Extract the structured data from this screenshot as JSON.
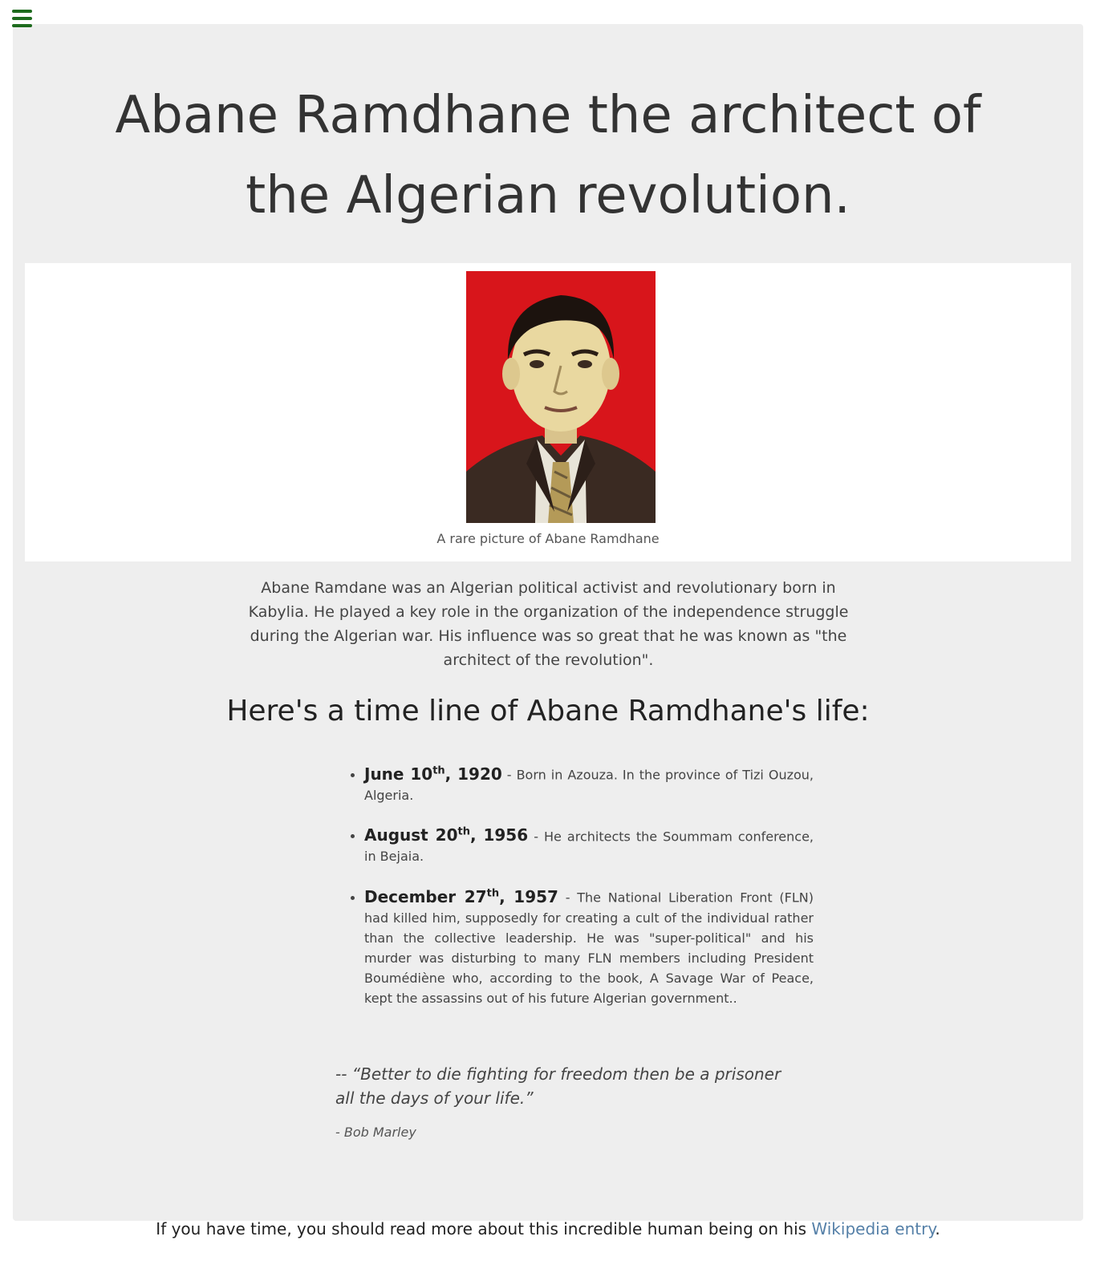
{
  "page": {
    "title": "Abane Ramdhane the architect of the Algerian revolution."
  },
  "figure": {
    "image_alt": "Portrait of Abane Ramdhane",
    "caption": "A rare picture of Abane Ramdhane"
  },
  "intro": "Abane Ramdane was an Algerian political activist and revolutionary born in Kabylia. He played a key role in the organization of the independence struggle during the Algerian war. His influence was so great that he was known as \"the architect of the revolution\".",
  "timeline": {
    "heading": "Here's a time line of Abane Ramdhane's life:",
    "items": [
      {
        "date_month": "June 10",
        "date_suffix": "th",
        "date_year": ", 1920",
        "text": " - Born in Azouza. In the province of Tizi Ouzou, Algeria."
      },
      {
        "date_month": "August 20",
        "date_suffix": "th",
        "date_year": ", 1956",
        "text": " - He architects the Soummam conference, in Bejaia."
      },
      {
        "date_month": "December 27",
        "date_suffix": "th",
        "date_year": ", 1957",
        "text": " - The National Liberation Front (FLN) had killed him, supposedly for creating a cult of the individual rather than the collective leadership. He was \"super-political\" and his murder was disturbing to many FLN members including President Boumédiène who, according to the book, A Savage War of Peace, kept the assassins out of his future Algerian government.."
      }
    ]
  },
  "quote": {
    "text": "-- “Better to die fighting for freedom then be a prisoner all the days of your life.”",
    "author": "- Bob Marley"
  },
  "footer": {
    "text": "If you have time, you should read more about this incredible human being on his ",
    "link_text": "Wikipedia entry",
    "end": "."
  },
  "colors": {
    "menu_icon": "#1e6b1e",
    "main_bg": "#eeeeee",
    "link": "#5580a8",
    "portrait_bg": "#d8151b"
  },
  "icons": {
    "menu": "hamburger-menu-icon"
  }
}
